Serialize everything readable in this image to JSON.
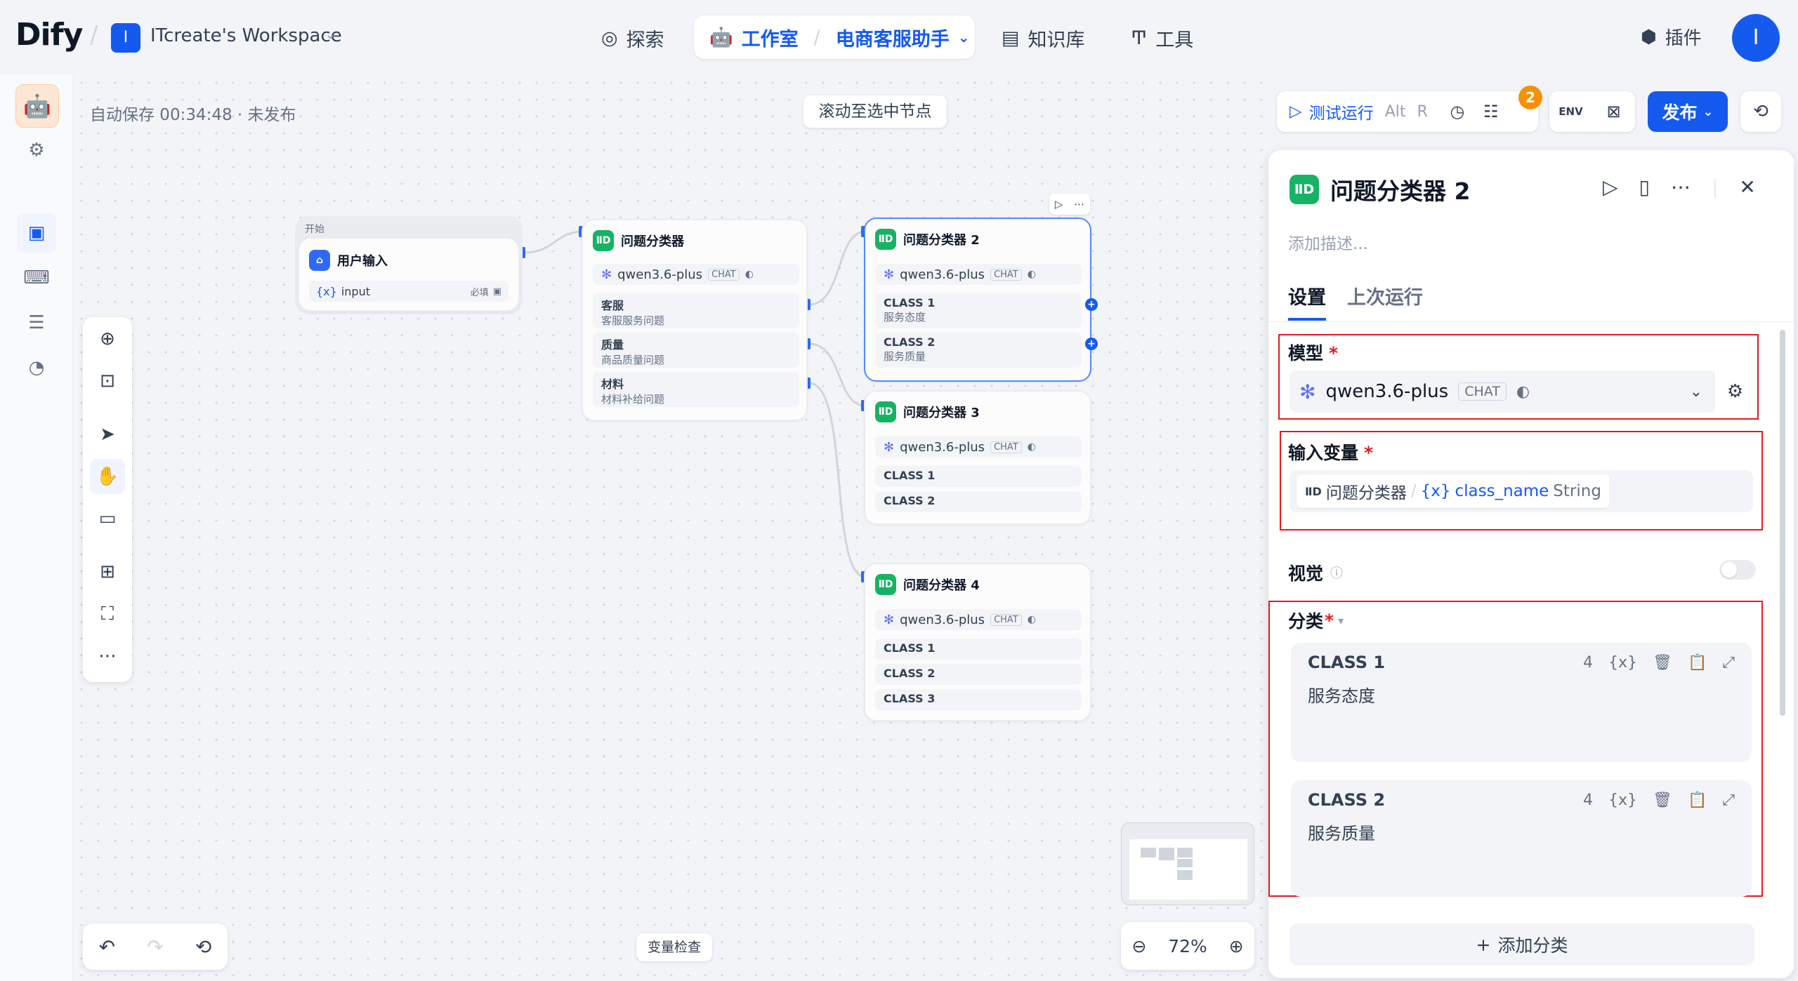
{
  "topbar": {
    "logo": "Dify",
    "workspace_badge": "I",
    "workspace_name": "ITcreate's Workspace",
    "nav": {
      "explore": "探索",
      "studio": "工作室",
      "app_name": "电商客服助手",
      "knowledge": "知识库",
      "tools": "工具"
    },
    "plugins": "插件",
    "avatar": "I"
  },
  "canvas": {
    "autosave": "自动保存 00:34:48 · 未发布",
    "scroll_to_selected": "滚动至选中节点",
    "test_run": "测试运行",
    "shortcut_alt": "Alt",
    "shortcut_r": "R",
    "checklist_count": "2",
    "env_label": "ENV",
    "publish": "发布",
    "variable_check": "变量检查",
    "zoom": "72%"
  },
  "nodes": {
    "start": {
      "header": "开始",
      "title": "用户输入",
      "var_icon": "{x}",
      "var_name": "input",
      "required": "必填"
    },
    "classifier1": {
      "title": "问题分类器",
      "model": "qwen3.6-plus",
      "chat": "CHAT",
      "classes": [
        {
          "name": "客服",
          "desc": "客服服务问题"
        },
        {
          "name": "质量",
          "desc": "商品质量问题"
        },
        {
          "name": "材料",
          "desc": "材料补给问题"
        }
      ]
    },
    "classifier2": {
      "title": "问题分类器 2",
      "model": "qwen3.6-plus",
      "chat": "CHAT",
      "classes": [
        {
          "name": "CLASS 1",
          "desc": "服务态度"
        },
        {
          "name": "CLASS 2",
          "desc": "服务质量"
        }
      ]
    },
    "classifier3": {
      "title": "问题分类器 3",
      "model": "qwen3.6-plus",
      "chat": "CHAT",
      "classes": [
        {
          "name": "CLASS 1"
        },
        {
          "name": "CLASS 2"
        }
      ]
    },
    "classifier4": {
      "title": "问题分类器 4",
      "model": "qwen3.6-plus",
      "chat": "CHAT",
      "classes": [
        {
          "name": "CLASS 1"
        },
        {
          "name": "CLASS 2"
        },
        {
          "name": "CLASS 3"
        }
      ]
    }
  },
  "panel": {
    "title": "问题分类器 2",
    "description_placeholder": "添加描述...",
    "tabs": [
      "设置",
      "上次运行"
    ],
    "model_label": "模型",
    "required_mark": "*",
    "model_name": "qwen3.6-plus",
    "model_chat": "CHAT",
    "input_var_label": "输入变量",
    "input_var": {
      "node": "问题分类器",
      "separator": "/",
      "var_icon": "{x}",
      "var_name": "class_name",
      "type": "String"
    },
    "vision_label": "视觉",
    "classes_label": "分类",
    "classes": [
      {
        "title": "CLASS 1",
        "count": "4",
        "var_icon": "{x}",
        "content": "服务态度"
      },
      {
        "title": "CLASS 2",
        "count": "4",
        "var_icon": "{x}",
        "content": "服务质量"
      }
    ],
    "add_class": "添加分类"
  },
  "colors": {
    "accent": "#155aef",
    "classifier_icon": "#16b364",
    "highlight_border": "#e31b1b",
    "badge": "#f79009"
  }
}
